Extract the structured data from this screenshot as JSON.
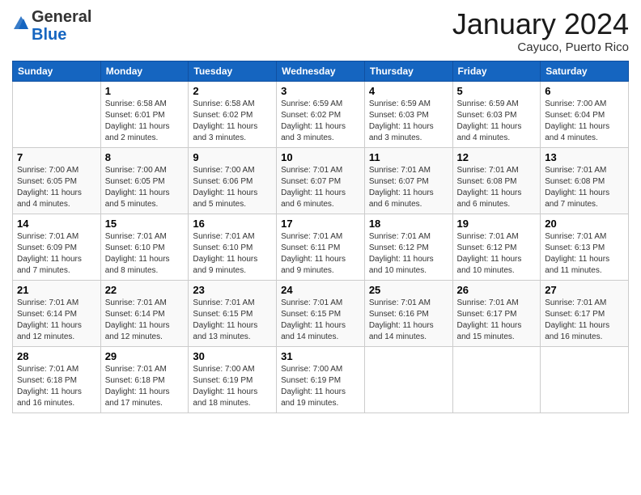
{
  "logo": {
    "general": "General",
    "blue": "Blue"
  },
  "header": {
    "title": "January 2024",
    "location": "Cayuco, Puerto Rico"
  },
  "days_of_week": [
    "Sunday",
    "Monday",
    "Tuesday",
    "Wednesday",
    "Thursday",
    "Friday",
    "Saturday"
  ],
  "weeks": [
    [
      {
        "day": "",
        "info": ""
      },
      {
        "day": "1",
        "info": "Sunrise: 6:58 AM\nSunset: 6:01 PM\nDaylight: 11 hours\nand 2 minutes."
      },
      {
        "day": "2",
        "info": "Sunrise: 6:58 AM\nSunset: 6:02 PM\nDaylight: 11 hours\nand 3 minutes."
      },
      {
        "day": "3",
        "info": "Sunrise: 6:59 AM\nSunset: 6:02 PM\nDaylight: 11 hours\nand 3 minutes."
      },
      {
        "day": "4",
        "info": "Sunrise: 6:59 AM\nSunset: 6:03 PM\nDaylight: 11 hours\nand 3 minutes."
      },
      {
        "day": "5",
        "info": "Sunrise: 6:59 AM\nSunset: 6:03 PM\nDaylight: 11 hours\nand 4 minutes."
      },
      {
        "day": "6",
        "info": "Sunrise: 7:00 AM\nSunset: 6:04 PM\nDaylight: 11 hours\nand 4 minutes."
      }
    ],
    [
      {
        "day": "7",
        "info": "Sunrise: 7:00 AM\nSunset: 6:05 PM\nDaylight: 11 hours\nand 4 minutes."
      },
      {
        "day": "8",
        "info": "Sunrise: 7:00 AM\nSunset: 6:05 PM\nDaylight: 11 hours\nand 5 minutes."
      },
      {
        "day": "9",
        "info": "Sunrise: 7:00 AM\nSunset: 6:06 PM\nDaylight: 11 hours\nand 5 minutes."
      },
      {
        "day": "10",
        "info": "Sunrise: 7:01 AM\nSunset: 6:07 PM\nDaylight: 11 hours\nand 6 minutes."
      },
      {
        "day": "11",
        "info": "Sunrise: 7:01 AM\nSunset: 6:07 PM\nDaylight: 11 hours\nand 6 minutes."
      },
      {
        "day": "12",
        "info": "Sunrise: 7:01 AM\nSunset: 6:08 PM\nDaylight: 11 hours\nand 6 minutes."
      },
      {
        "day": "13",
        "info": "Sunrise: 7:01 AM\nSunset: 6:08 PM\nDaylight: 11 hours\nand 7 minutes."
      }
    ],
    [
      {
        "day": "14",
        "info": "Sunrise: 7:01 AM\nSunset: 6:09 PM\nDaylight: 11 hours\nand 7 minutes."
      },
      {
        "day": "15",
        "info": "Sunrise: 7:01 AM\nSunset: 6:10 PM\nDaylight: 11 hours\nand 8 minutes."
      },
      {
        "day": "16",
        "info": "Sunrise: 7:01 AM\nSunset: 6:10 PM\nDaylight: 11 hours\nand 9 minutes."
      },
      {
        "day": "17",
        "info": "Sunrise: 7:01 AM\nSunset: 6:11 PM\nDaylight: 11 hours\nand 9 minutes."
      },
      {
        "day": "18",
        "info": "Sunrise: 7:01 AM\nSunset: 6:12 PM\nDaylight: 11 hours\nand 10 minutes."
      },
      {
        "day": "19",
        "info": "Sunrise: 7:01 AM\nSunset: 6:12 PM\nDaylight: 11 hours\nand 10 minutes."
      },
      {
        "day": "20",
        "info": "Sunrise: 7:01 AM\nSunset: 6:13 PM\nDaylight: 11 hours\nand 11 minutes."
      }
    ],
    [
      {
        "day": "21",
        "info": "Sunrise: 7:01 AM\nSunset: 6:14 PM\nDaylight: 11 hours\nand 12 minutes."
      },
      {
        "day": "22",
        "info": "Sunrise: 7:01 AM\nSunset: 6:14 PM\nDaylight: 11 hours\nand 12 minutes."
      },
      {
        "day": "23",
        "info": "Sunrise: 7:01 AM\nSunset: 6:15 PM\nDaylight: 11 hours\nand 13 minutes."
      },
      {
        "day": "24",
        "info": "Sunrise: 7:01 AM\nSunset: 6:15 PM\nDaylight: 11 hours\nand 14 minutes."
      },
      {
        "day": "25",
        "info": "Sunrise: 7:01 AM\nSunset: 6:16 PM\nDaylight: 11 hours\nand 14 minutes."
      },
      {
        "day": "26",
        "info": "Sunrise: 7:01 AM\nSunset: 6:17 PM\nDaylight: 11 hours\nand 15 minutes."
      },
      {
        "day": "27",
        "info": "Sunrise: 7:01 AM\nSunset: 6:17 PM\nDaylight: 11 hours\nand 16 minutes."
      }
    ],
    [
      {
        "day": "28",
        "info": "Sunrise: 7:01 AM\nSunset: 6:18 PM\nDaylight: 11 hours\nand 16 minutes."
      },
      {
        "day": "29",
        "info": "Sunrise: 7:01 AM\nSunset: 6:18 PM\nDaylight: 11 hours\nand 17 minutes."
      },
      {
        "day": "30",
        "info": "Sunrise: 7:00 AM\nSunset: 6:19 PM\nDaylight: 11 hours\nand 18 minutes."
      },
      {
        "day": "31",
        "info": "Sunrise: 7:00 AM\nSunset: 6:19 PM\nDaylight: 11 hours\nand 19 minutes."
      },
      {
        "day": "",
        "info": ""
      },
      {
        "day": "",
        "info": ""
      },
      {
        "day": "",
        "info": ""
      }
    ]
  ]
}
